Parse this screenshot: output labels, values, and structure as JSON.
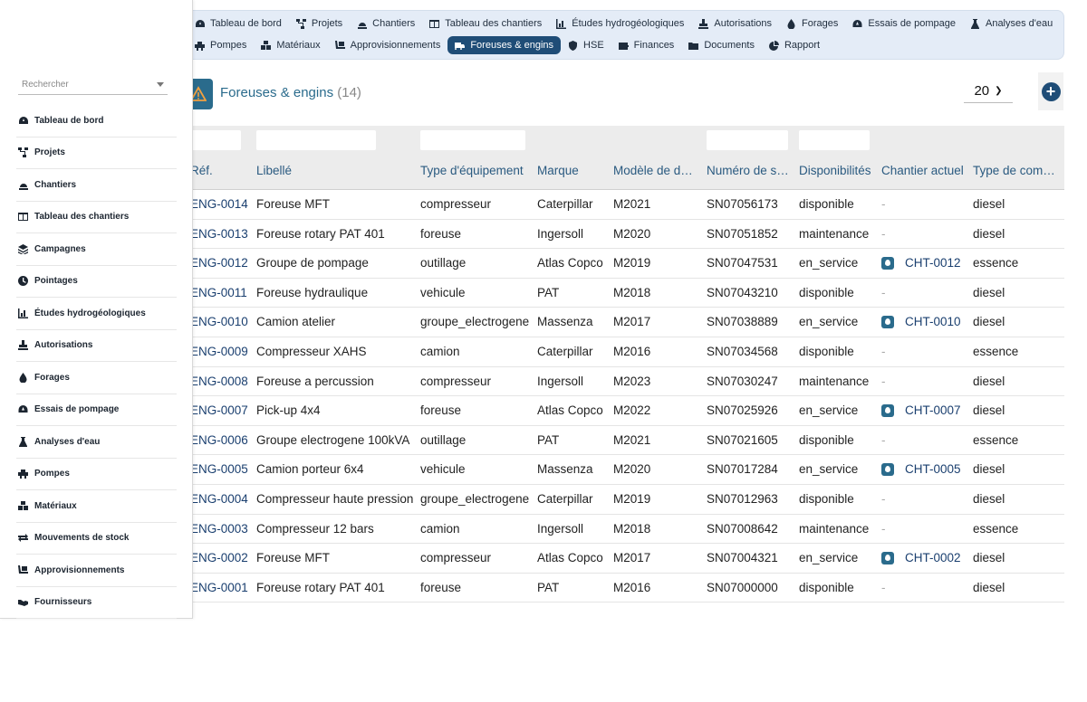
{
  "topnav": {
    "row1": [
      {
        "label": "Tableau de bord",
        "icon": "dashboard-icon"
      },
      {
        "label": "Projets",
        "icon": "project-tree-icon"
      },
      {
        "label": "Chantiers",
        "icon": "hard-hat-icon"
      },
      {
        "label": "Tableau des chantiers",
        "icon": "table-icon"
      },
      {
        "label": "Études hydrogéologiques",
        "icon": "chart-icon"
      },
      {
        "label": "Autorisations",
        "icon": "stamp-icon"
      },
      {
        "label": "Forages",
        "icon": "drop-icon"
      },
      {
        "label": "Essais de pompage",
        "icon": "gauge-icon"
      },
      {
        "label": "Analyses d'eau",
        "icon": "flask-icon"
      }
    ],
    "row2": [
      {
        "label": "Pompes",
        "icon": "pump-icon"
      },
      {
        "label": "Matériaux",
        "icon": "cubes-icon"
      },
      {
        "label": "Approvisionnements",
        "icon": "dolly-icon"
      },
      {
        "label": "Foreuses & engins",
        "icon": "truck-icon",
        "active": true
      },
      {
        "label": "HSE",
        "icon": "shield-icon"
      },
      {
        "label": "Finances",
        "icon": "wallet-icon"
      },
      {
        "label": "Documents",
        "icon": "folder-icon"
      },
      {
        "label": "Rapport",
        "icon": "pie-icon"
      }
    ]
  },
  "sidebar": {
    "search_placeholder": "Rechercher",
    "items": [
      {
        "label": "Tableau de bord",
        "icon": "dashboard-icon"
      },
      {
        "label": "Projets",
        "icon": "project-tree-icon"
      },
      {
        "label": "Chantiers",
        "icon": "hard-hat-icon"
      },
      {
        "label": "Tableau des chantiers",
        "icon": "table-icon"
      },
      {
        "label": "Campagnes",
        "icon": "layers-icon"
      },
      {
        "label": "Pointages",
        "icon": "clock-icon"
      },
      {
        "label": "Études hydrogéologiques",
        "icon": "chart-icon"
      },
      {
        "label": "Autorisations",
        "icon": "stamp-icon"
      },
      {
        "label": "Forages",
        "icon": "drop-icon"
      },
      {
        "label": "Essais de pompage",
        "icon": "gauge-icon"
      },
      {
        "label": "Analyses d'eau",
        "icon": "flask-icon"
      },
      {
        "label": "Pompes",
        "icon": "pump-icon"
      },
      {
        "label": "Matériaux",
        "icon": "cubes-icon"
      },
      {
        "label": "Mouvements de stock",
        "icon": "exchange-icon"
      },
      {
        "label": "Approvisionnements",
        "icon": "dolly-icon"
      },
      {
        "label": "Fournisseurs",
        "icon": "handshake-icon"
      }
    ]
  },
  "header": {
    "title": "Foreuses & engins",
    "count": "(14)",
    "page_size": "20"
  },
  "table": {
    "columns": [
      "Réf.",
      "Libellé",
      "Type d'équipement",
      "Marque",
      "Modèle de d…",
      "Numéro de s…",
      "Disponibilités",
      "Chantier actuel",
      "Type de com…"
    ],
    "rows": [
      [
        "ENG-0014",
        "Foreuse MFT",
        "compresseur",
        "Caterpillar",
        "M2021",
        "SN07056173",
        "disponible",
        "-",
        "diesel"
      ],
      [
        "ENG-0013",
        "Foreuse rotary PAT 401",
        "foreuse",
        "Ingersoll",
        "M2020",
        "SN07051852",
        "maintenance",
        "-",
        "diesel"
      ],
      [
        "ENG-0012",
        "Groupe de pompage",
        "outillage",
        "Atlas Copco",
        "M2019",
        "SN07047531",
        "en_service",
        "CHT-0012",
        "essence"
      ],
      [
        "ENG-0011",
        "Foreuse hydraulique",
        "vehicule",
        "PAT",
        "M2018",
        "SN07043210",
        "disponible",
        "-",
        "diesel"
      ],
      [
        "ENG-0010",
        "Camion atelier",
        "groupe_electrogene",
        "Massenza",
        "M2017",
        "SN07038889",
        "en_service",
        "CHT-0010",
        "diesel"
      ],
      [
        "ENG-0009",
        "Compresseur XAHS",
        "camion",
        "Caterpillar",
        "M2016",
        "SN07034568",
        "disponible",
        "-",
        "essence"
      ],
      [
        "ENG-0008",
        "Foreuse a percussion",
        "compresseur",
        "Ingersoll",
        "M2023",
        "SN07030247",
        "maintenance",
        "-",
        "diesel"
      ],
      [
        "ENG-0007",
        "Pick-up 4x4",
        "foreuse",
        "Atlas Copco",
        "M2022",
        "SN07025926",
        "en_service",
        "CHT-0007",
        "diesel"
      ],
      [
        "ENG-0006",
        "Groupe electrogene 100kVA",
        "outillage",
        "PAT",
        "M2021",
        "SN07021605",
        "disponible",
        "-",
        "essence"
      ],
      [
        "ENG-0005",
        "Camion porteur 6x4",
        "vehicule",
        "Massenza",
        "M2020",
        "SN07017284",
        "en_service",
        "CHT-0005",
        "diesel"
      ],
      [
        "ENG-0004",
        "Compresseur haute pression",
        "groupe_electrogene",
        "Caterpillar",
        "M2019",
        "SN07012963",
        "disponible",
        "-",
        "diesel"
      ],
      [
        "ENG-0003",
        "Compresseur 12 bars",
        "camion",
        "Ingersoll",
        "M2018",
        "SN07008642",
        "maintenance",
        "-",
        "essence"
      ],
      [
        "ENG-0002",
        "Foreuse MFT",
        "compresseur",
        "Atlas Copco",
        "M2017",
        "SN07004321",
        "en_service",
        "CHT-0002",
        "diesel"
      ],
      [
        "ENG-0001",
        "Foreuse rotary PAT 401",
        "foreuse",
        "PAT",
        "M2016",
        "SN07000000",
        "disponible",
        "-",
        "diesel"
      ]
    ]
  },
  "colors": {
    "accent": "#1f4d77",
    "title": "#2a6b8c",
    "nav_bg": "#e4ecf7",
    "link": "#1a3f6f"
  }
}
